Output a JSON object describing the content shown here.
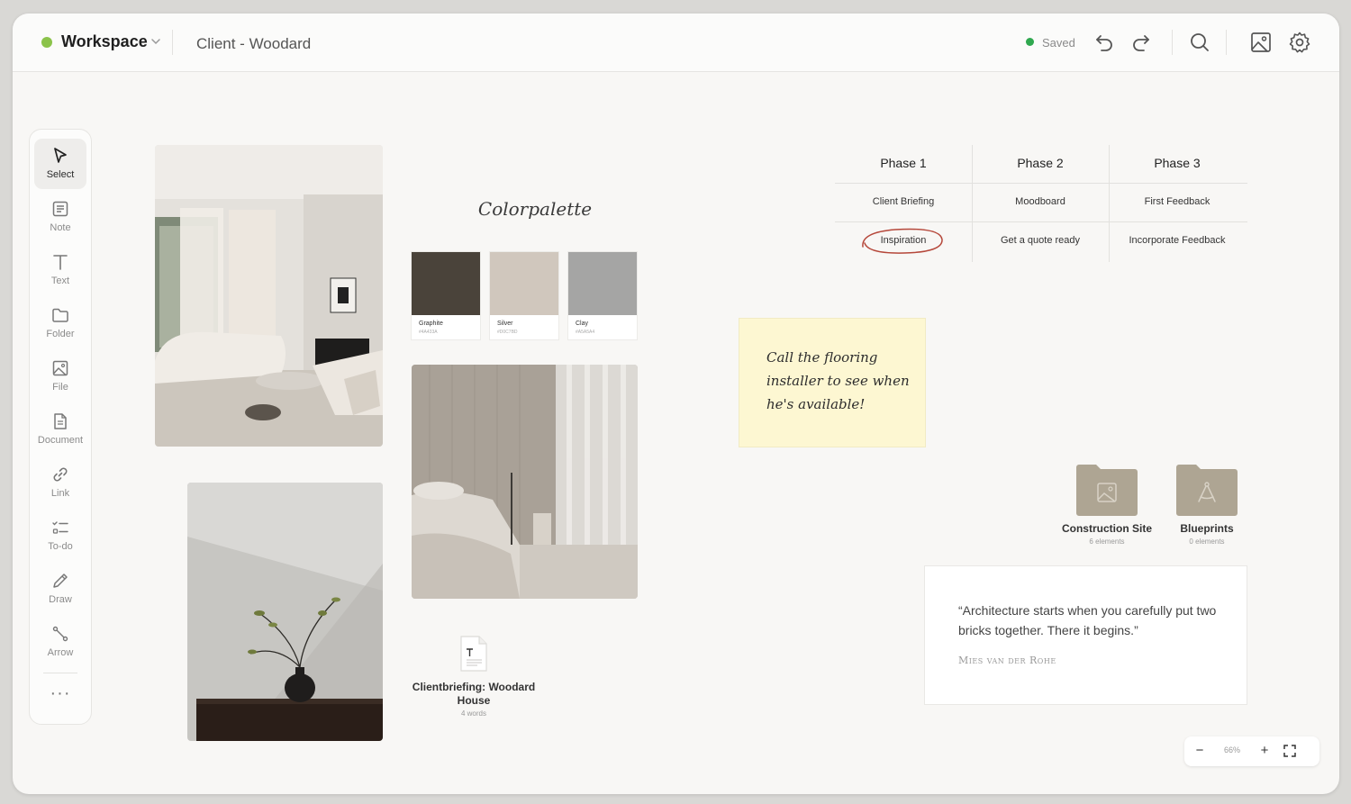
{
  "topbar": {
    "workspace_label": "Workspace",
    "board_name": "Client - Woodard",
    "saved_label": "Saved",
    "status_color": "#2fa84f",
    "workspace_dot_color": "#8bc34a"
  },
  "sidebar": {
    "tools": [
      {
        "label": "Select",
        "icon": "cursor-icon",
        "active": true
      },
      {
        "label": "Note",
        "icon": "note-icon"
      },
      {
        "label": "Text",
        "icon": "text-icon"
      },
      {
        "label": "Folder",
        "icon": "folder-icon"
      },
      {
        "label": "File",
        "icon": "image-file-icon"
      },
      {
        "label": "Document",
        "icon": "document-icon"
      },
      {
        "label": "Link",
        "icon": "link-icon"
      },
      {
        "label": "To-do",
        "icon": "todo-icon"
      },
      {
        "label": "Draw",
        "icon": "pencil-icon"
      },
      {
        "label": "Arrow",
        "icon": "arrow-icon"
      }
    ],
    "more_label": "···"
  },
  "colorpalette": {
    "title": "Colorpalette",
    "swatches": [
      {
        "name": "Graphite",
        "hex": "#4A433A",
        "color": "#4a433a"
      },
      {
        "name": "Silver",
        "hex": "#D0C7BD",
        "color": "#d0c7bd"
      },
      {
        "name": "Clay",
        "hex": "#A5A5A4",
        "color": "#a5a5a4"
      }
    ]
  },
  "phases": {
    "columns": [
      {
        "header": "Phase 1",
        "row1": "Client Briefing",
        "row2": "Inspiration"
      },
      {
        "header": "Phase 2",
        "row1": "Moodboard",
        "row2": "Get a quote ready"
      },
      {
        "header": "Phase 3",
        "row1": "First Feedback",
        "row2": "Incorporate Feedback"
      }
    ],
    "highlight_color": "#b5473a"
  },
  "sticky_note": {
    "text": "Call the flooring installer to see when he's available!",
    "color": "#fdf7d2"
  },
  "folders": [
    {
      "name": "Construction Site",
      "count": "6 elements",
      "icon": "image-file-icon"
    },
    {
      "name": "Blueprints",
      "count": "0 elements",
      "icon": "compass-icon"
    }
  ],
  "quote": {
    "text": "“Architecture starts when you carefully put two bricks together. There it begins.”",
    "author": "Mies van der Rohe"
  },
  "document": {
    "name": "Clientbriefing: Woodard House",
    "count": "4 words"
  },
  "zoom": {
    "minus": "−",
    "value": "66%",
    "plus": "+"
  }
}
